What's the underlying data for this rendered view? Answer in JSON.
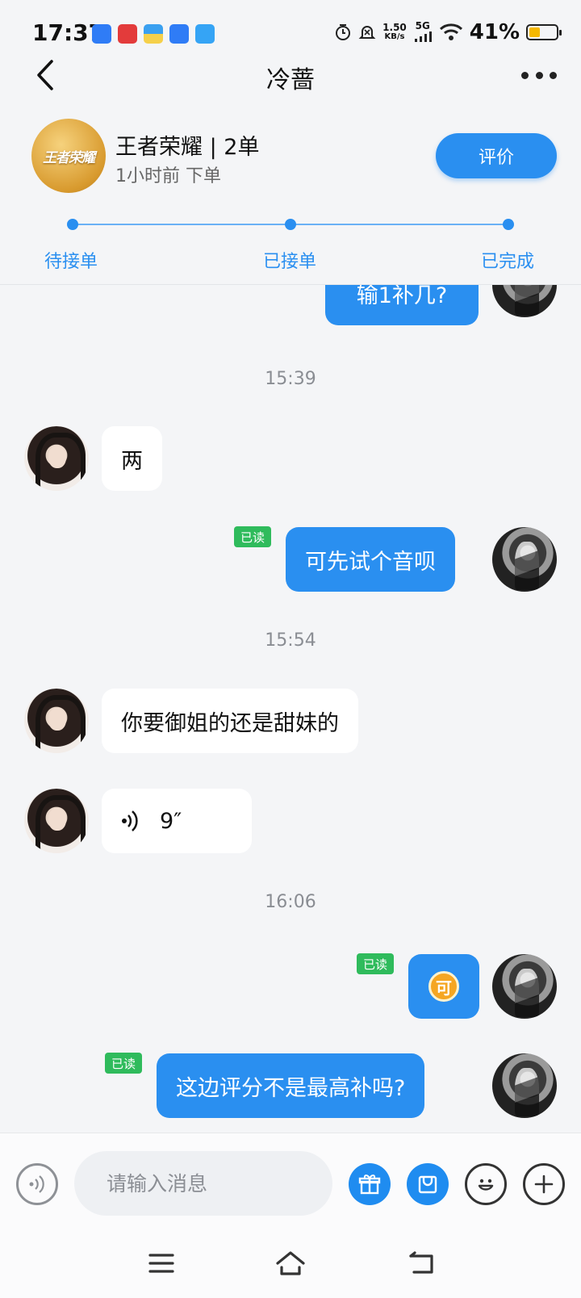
{
  "status_bar": {
    "time": "17:37",
    "net_speed": "1.50",
    "net_unit": "KB/s",
    "network": "5G",
    "battery_pct": "41%",
    "battery_level": 0.41
  },
  "header": {
    "title": "冷蔷"
  },
  "order": {
    "logo_text": "王者荣耀",
    "title": "王者荣耀 | 2单",
    "time": "1小时前 下单",
    "rate_button": "评价",
    "steps": [
      "待接单",
      "已接单",
      "已完成"
    ]
  },
  "messages": [
    {
      "side": "out",
      "text": "输1补几?",
      "partial": true
    },
    {
      "type": "time",
      "text": "15:39"
    },
    {
      "side": "in",
      "text": "两"
    },
    {
      "side": "out",
      "text": "可先试个音呗",
      "read": "已读"
    },
    {
      "type": "time",
      "text": "15:54"
    },
    {
      "side": "in",
      "text": "你要御姐的还是甜妹的"
    },
    {
      "side": "in",
      "type": "voice",
      "duration": "9″"
    },
    {
      "type": "time",
      "text": "16:06"
    },
    {
      "side": "out",
      "type": "emoji",
      "text": "可",
      "read": "已读"
    },
    {
      "side": "out",
      "text": "这边评分不是最高补吗?",
      "read": "已读"
    }
  ],
  "input": {
    "placeholder": "请输入消息"
  },
  "icons": {
    "voice": "voice-wave-icon",
    "gift": "gift-icon",
    "coupon": "coupon-icon",
    "emoji": "smile-icon",
    "plus": "plus-icon"
  },
  "colors": {
    "accent": "#2a8ff0",
    "read_tag": "#2fbb5c",
    "background": "#f4f5f7"
  }
}
